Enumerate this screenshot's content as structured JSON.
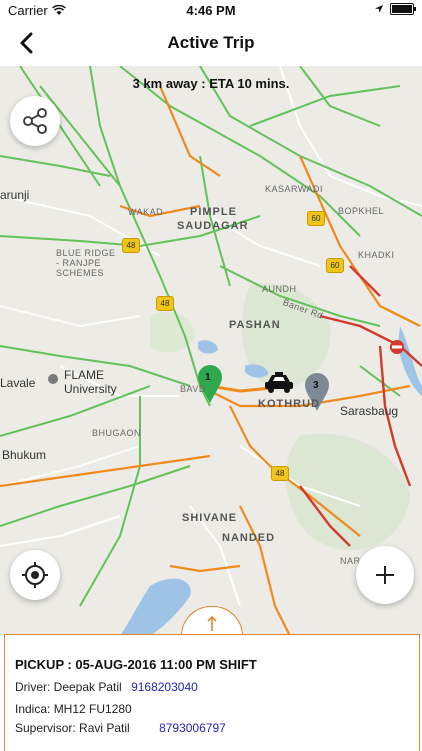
{
  "status_bar": {
    "carrier": "Carrier",
    "time": "4:46 PM"
  },
  "nav": {
    "title": "Active Trip"
  },
  "map": {
    "eta": "3 km away : ETA 10 mins.",
    "labels": {
      "pimple": "PIMPLE",
      "saudagar": "SAUDAGAR",
      "wakad": "WAKAD",
      "kasarwadi": "KASARWADI",
      "bopkhel": "BOPKHEL",
      "khadki": "KHADKI",
      "aundh": "AUNDH",
      "baner": "Baner Rd",
      "blue_ridge": "BLUE RIDGE",
      "ranjpe": "- RANJPE",
      "schemes": "SCHEMES",
      "marunji": "arunji",
      "pashan": "PASHAN",
      "flame1": "FLAME",
      "flame2": "University",
      "lavale": "Lavale",
      "bavdhan": "BAVD",
      "kothrud": "KOTHRUD",
      "sarasbaug": "Sarasbaug",
      "bhugaon": "BHUGAON",
      "bhukum": "Bhukum",
      "shivane": "SHIVANE",
      "nanded": "NANDED",
      "nar": "NAR"
    },
    "shields": [
      "48",
      "48",
      "60",
      "60",
      "48"
    ],
    "markers": {
      "pickup": "1",
      "stop": "3"
    }
  },
  "trip": {
    "pickup": "PICKUP : 05-AUG-2016 11:00 PM SHIFT",
    "driver_label": "Driver: Deepak Patil",
    "driver_phone": "9168203040",
    "vehicle_label": "Indica: MH12 FU1280",
    "supervisor_label": "Supervisor: Ravi Patil",
    "supervisor_phone": "8793006797"
  },
  "colors": {
    "accent": "#e08533",
    "traffic_green": "#63c15a",
    "traffic_orange": "#f08a1c",
    "traffic_red": "#d43a2b",
    "link": "#2424b4"
  }
}
